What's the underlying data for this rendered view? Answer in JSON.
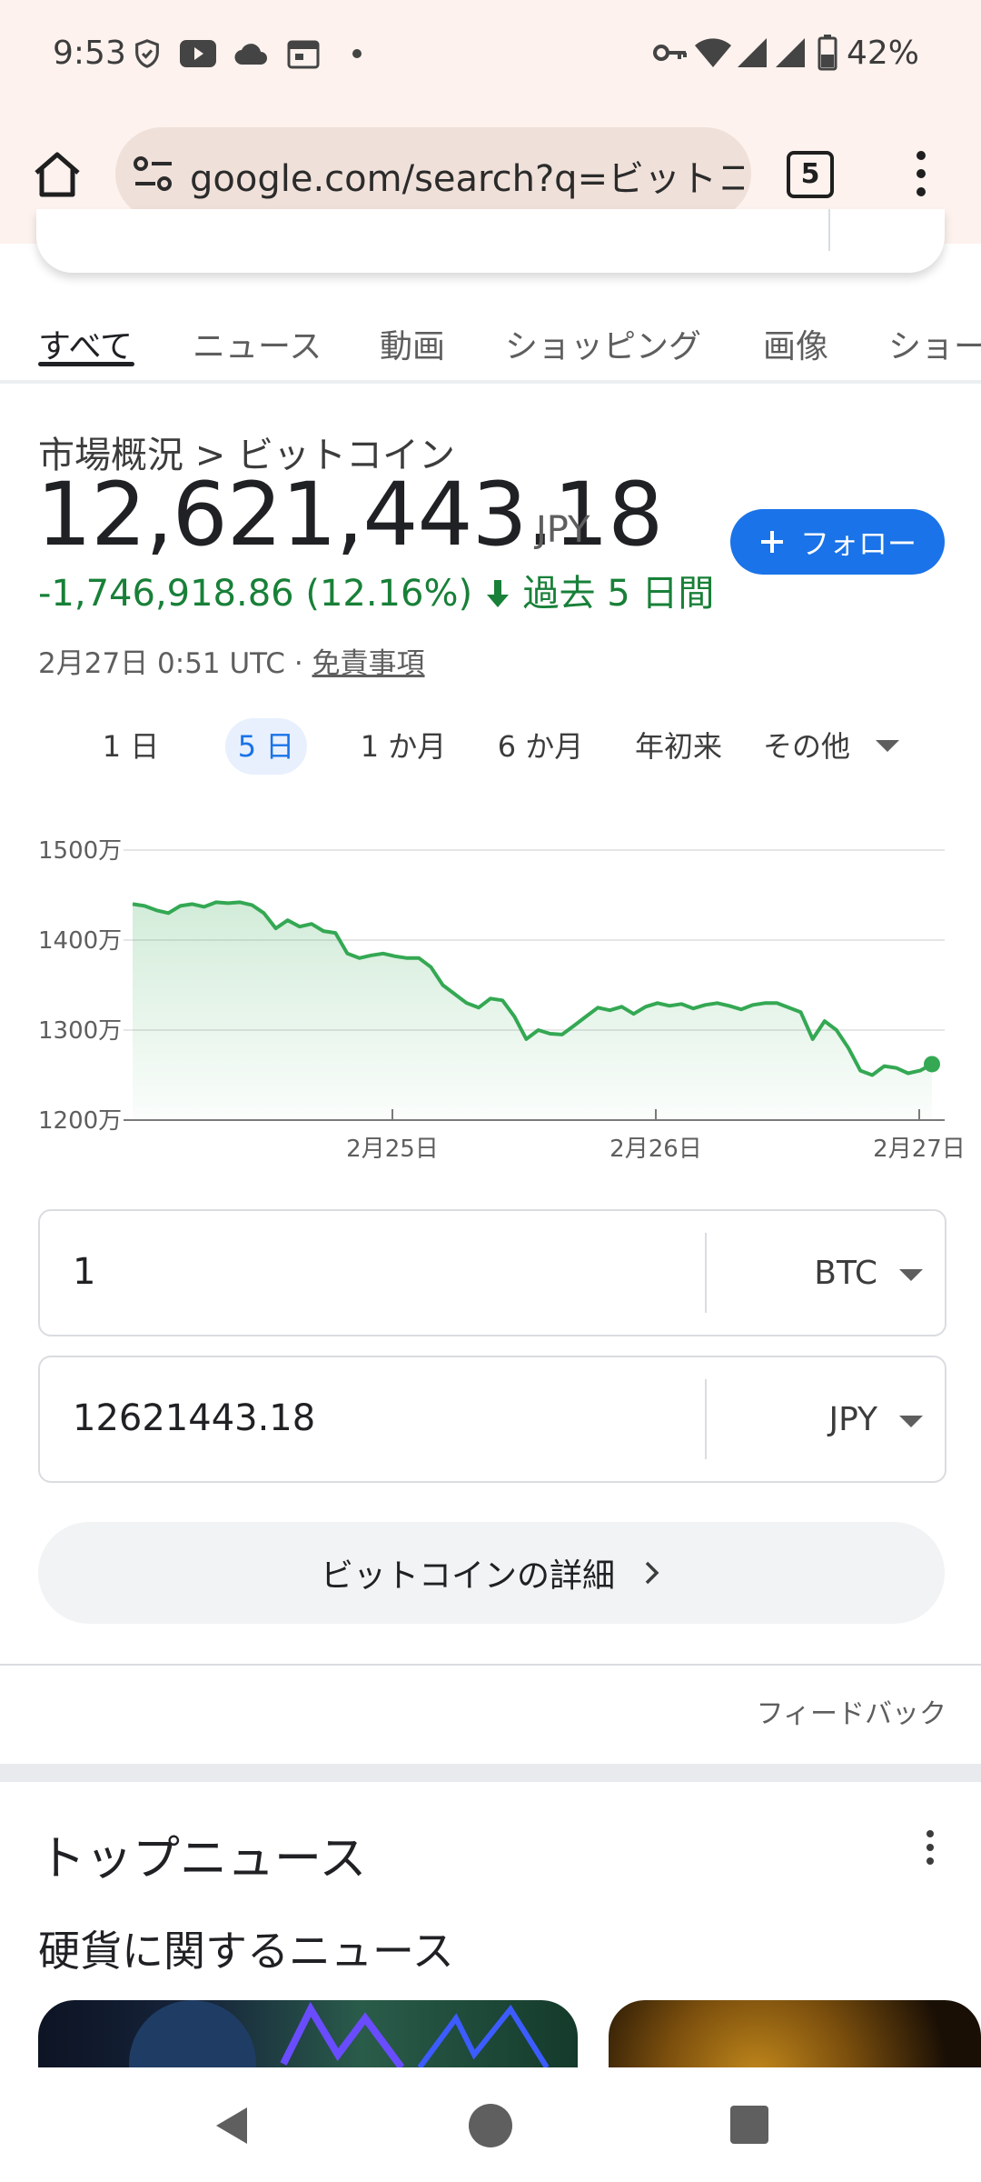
{
  "status_bar": {
    "time": "9:53",
    "battery": "42%",
    "icons": [
      "shield-icon",
      "youtube-icon",
      "cloud-icon",
      "calendar-icon",
      "dot-icon",
      "key-icon",
      "wifi-icon",
      "signal-icon",
      "battery-icon"
    ]
  },
  "browser": {
    "url": "google.com/search?q=ビットコ",
    "tab_count": "5"
  },
  "tabs": [
    "すべて",
    "ニュース",
    "動画",
    "ショッピング",
    "画像",
    "ショー"
  ],
  "quote": {
    "breadcrumb": "市場概況 > ビットコイン",
    "price": "12,621,443.18",
    "currency": "JPY",
    "change": "-1,746,918.86 (12.16%)",
    "change_period": "過去 5 日間",
    "follow_label": "フォロー",
    "datetime": "2月27日 0:51 UTC",
    "disclaimer": "免責事項"
  },
  "ranges": {
    "items": [
      "1 日",
      "5 日",
      "1 か月",
      "6 か月",
      "年初来",
      "その他"
    ],
    "selected": "5 日"
  },
  "chart_data": {
    "type": "area",
    "ylabels": [
      "1500万",
      "1400万",
      "1300万",
      "1200万"
    ],
    "ylim": [
      12000000,
      15000000
    ],
    "xlabels": [
      "2月25日",
      "2月26日",
      "2月27日"
    ],
    "line_color": "#34a853",
    "values": [
      14400000,
      14380000,
      14330000,
      14300000,
      14380000,
      14400000,
      14370000,
      14420000,
      14410000,
      14420000,
      14390000,
      14300000,
      14130000,
      14220000,
      14150000,
      14180000,
      14100000,
      14080000,
      13850000,
      13800000,
      13830000,
      13850000,
      13820000,
      13800000,
      13800000,
      13700000,
      13500000,
      13400000,
      13300000,
      13250000,
      13350000,
      13330000,
      13150000,
      12900000,
      13000000,
      12960000,
      12950000,
      13050000,
      13150000,
      13250000,
      13220000,
      13260000,
      13180000,
      13260000,
      13300000,
      13270000,
      13290000,
      13240000,
      13280000,
      13300000,
      13270000,
      13230000,
      13280000,
      13300000,
      13300000,
      13250000,
      13200000,
      12900000,
      13100000,
      13000000,
      12800000,
      12550000,
      12500000,
      12600000,
      12580000,
      12520000,
      12550000,
      12621443
    ]
  },
  "converter": {
    "from_value": "1",
    "from_unit": "BTC",
    "to_value": "12621443.18",
    "to_unit": "JPY"
  },
  "details_label": "ビットコインの詳細",
  "feedback": "フィードバック",
  "top_news": "トップニュース",
  "coin_news": "硬貨に関するニュース"
}
